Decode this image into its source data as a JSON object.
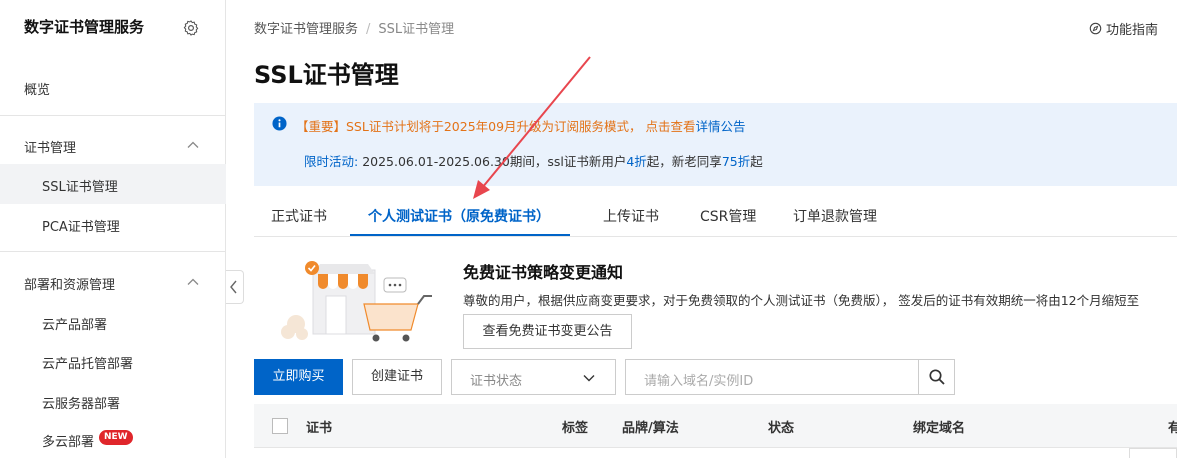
{
  "sidebar": {
    "title": "数字证书管理服务",
    "overview": "概览",
    "groups": [
      {
        "label": "证书管理",
        "items": [
          "SSL证书管理",
          "PCA证书管理"
        ]
      },
      {
        "label": "部署和资源管理",
        "items": [
          "云产品部署",
          "云产品托管部署",
          "云服务器部署",
          "多云部署"
        ]
      }
    ],
    "new_badge": "NEW"
  },
  "header": {
    "breadcrumb": [
      "数字证书管理服务",
      "SSL证书管理"
    ],
    "guide": "功能指南",
    "title": "SSL证书管理"
  },
  "notice": {
    "line1_prefix": "【重要】SSL证书计划将于2025年09月升级为订阅服务模式， 点击查看",
    "line1_link": "详情公告",
    "line2_label": "限时活动:",
    "line2_a": " 2025.06.01-2025.06.30期间，ssl证书新用户",
    "line2_b": "4折",
    "line2_c": "起，新老同享",
    "line2_d": "75折",
    "line2_e": "起"
  },
  "tabs": [
    "正式证书",
    "个人测试证书（原免费证书）",
    "上传证书",
    "CSR管理",
    "订单退款管理"
  ],
  "banner": {
    "title": "免费证书策略变更通知",
    "text": "尊敬的用户，根据供应商变更要求，对于免费领取的个人测试证书（免费版）， 签发后的证书有效期统一将由12个月缩短至",
    "button": "查看免费证书变更公告"
  },
  "toolbar": {
    "buy": "立即购买",
    "create": "创建证书",
    "status_placeholder": "证书状态",
    "search_placeholder": "请输入域名/实例ID"
  },
  "table": {
    "columns": [
      "证书",
      "标签",
      "品牌/算法",
      "状态",
      "绑定域名",
      "有"
    ]
  },
  "colors": {
    "primary": "#0064c8",
    "warning": "#e37318",
    "arrow": "#e8464e",
    "notice_bg": "#eaf2fc"
  }
}
